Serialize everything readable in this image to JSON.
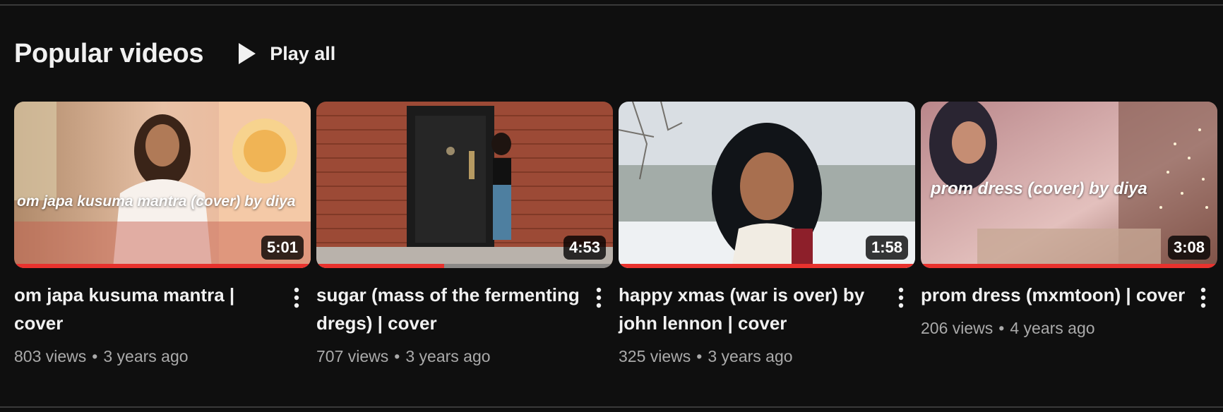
{
  "shelf": {
    "title": "Popular videos",
    "play_all_label": "Play all"
  },
  "videos": [
    {
      "title": "om japa kusuma mantra | cover",
      "views": "803 views",
      "age": "3 years ago",
      "duration": "5:01",
      "overlay_text": "om japa kusuma mantra (cover) by diya",
      "watched_fraction": 1.0
    },
    {
      "title": "sugar (mass of the fermenting dregs) | cover",
      "views": "707 views",
      "age": "3 years ago",
      "duration": "4:53",
      "overlay_text": "",
      "watched_fraction": 0.43
    },
    {
      "title": "happy xmas (war is over) by john lennon | cover",
      "views": "325 views",
      "age": "3 years ago",
      "duration": "1:58",
      "overlay_text": "",
      "watched_fraction": 1.0
    },
    {
      "title": "prom dress (mxmtoon) | cover",
      "views": "206 views",
      "age": "4 years ago",
      "duration": "3:08",
      "overlay_text": "prom dress (cover) by diya",
      "watched_fraction": 1.0
    }
  ],
  "colors": {
    "background": "#0f0f0f",
    "progress": "#e8322e",
    "text_primary": "#f1f1f1",
    "text_secondary": "#aaaaaa"
  },
  "icons": {
    "play_all": "play-icon",
    "more": "more-vert-icon"
  }
}
